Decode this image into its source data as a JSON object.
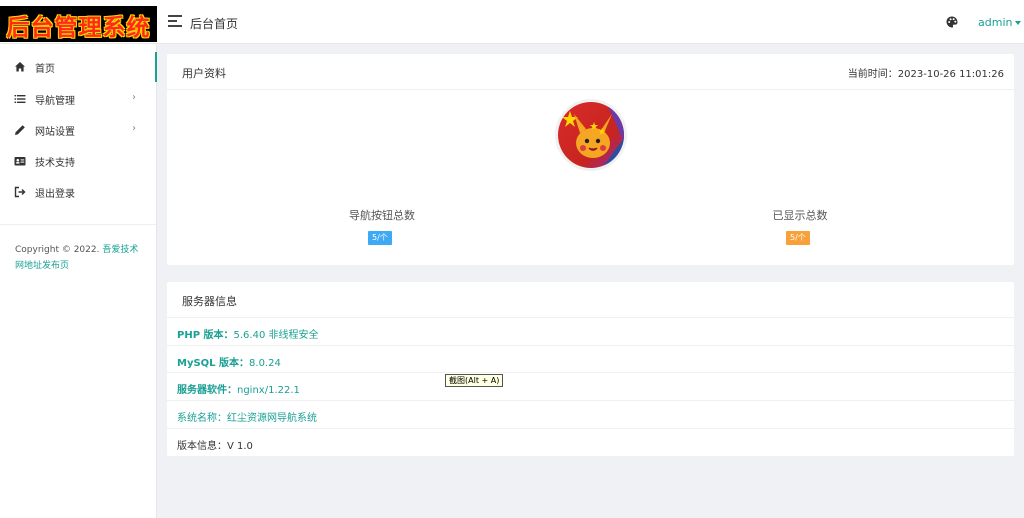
{
  "app": {
    "logo_text": "后台管理系统",
    "page_title": "后台首页",
    "user": "admin"
  },
  "sidebar": {
    "items": [
      {
        "label": "首页",
        "icon": "home-icon",
        "active": true
      },
      {
        "label": "导航管理",
        "icon": "list-icon",
        "has_children": true
      },
      {
        "label": "网站设置",
        "icon": "pencil-icon",
        "has_children": true
      },
      {
        "label": "技术支持",
        "icon": "id-card-icon"
      },
      {
        "label": "退出登录",
        "icon": "logout-icon"
      }
    ],
    "arrow": "›",
    "copyright_prefix": "Copyright © 2022.",
    "copyright_link": "吾爱技术网地址发布页"
  },
  "profile": {
    "title": "用户资料",
    "time_label": "当前时间：2023-10-26 11:01:26",
    "stats": [
      {
        "title": "导航按钮总数",
        "badge": "5/个",
        "color": "#3ea9f5"
      },
      {
        "title": "已显示总数",
        "badge": "5/个",
        "color": "#f8a13b"
      }
    ]
  },
  "server": {
    "title": "服务器信息",
    "rows": [
      {
        "label": "PHP 版本：",
        "value": "5.6.40 非线程安全",
        "style": "teal"
      },
      {
        "label": "MySQL 版本：",
        "value": "8.0.24",
        "style": "teal"
      },
      {
        "label": "服务器软件：",
        "value": "nginx/1.22.1",
        "style": "teal"
      },
      {
        "label": "系统名称：",
        "value": "红尘资源网导航系统",
        "style": "teal"
      },
      {
        "label": "版本信息：",
        "value": "V 1.0",
        "style": "dark"
      }
    ]
  },
  "tooltip": "截图(Alt + A)",
  "colors": {
    "accent": "#1aa094",
    "blue_badge": "#3ea9f5",
    "orange_badge": "#f8a13b",
    "background": "#f0f1f5"
  }
}
